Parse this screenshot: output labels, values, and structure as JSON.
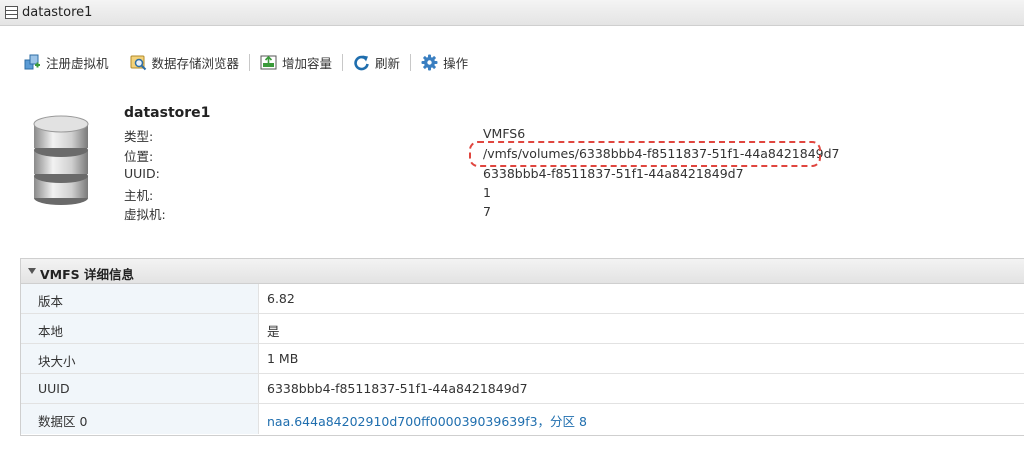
{
  "window": {
    "title": "datastore1",
    "icon": "datastore-icon"
  },
  "toolbar": {
    "register_vm": "注册虚拟机",
    "datastore_browser": "数据存储浏览器",
    "increase_capacity": "增加容量",
    "refresh": "刷新",
    "actions": "操作"
  },
  "summary": {
    "name": "datastore1",
    "rows": [
      {
        "label": "类型:",
        "value": "VMFS6"
      },
      {
        "label": "位置:",
        "value": "/vmfs/volumes/6338bbb4-f8511837-51f1-44a8421849d7"
      },
      {
        "label": "UUID:",
        "value": "6338bbb4-f8511837-51f1-44a8421849d7"
      },
      {
        "label": "主机:",
        "value": "1"
      },
      {
        "label": "虚拟机:",
        "value": "7"
      }
    ]
  },
  "vmfs_details": {
    "title": "VMFS 详细信息",
    "rows": [
      {
        "label": "版本",
        "value": "6.82"
      },
      {
        "label": "本地",
        "value": "是"
      },
      {
        "label": "块大小",
        "value": "1 MB"
      },
      {
        "label": "UUID",
        "value": "6338bbb4-f8511837-51f1-44a8421849d7"
      },
      {
        "label": "数据区 0",
        "value": "naa.644a84202910d700ff000039039639f3，分区 8"
      }
    ]
  },
  "colors": {
    "link": "#1f6eae",
    "highlight": "#e0463f",
    "label_bg": "#f1f6fa"
  }
}
